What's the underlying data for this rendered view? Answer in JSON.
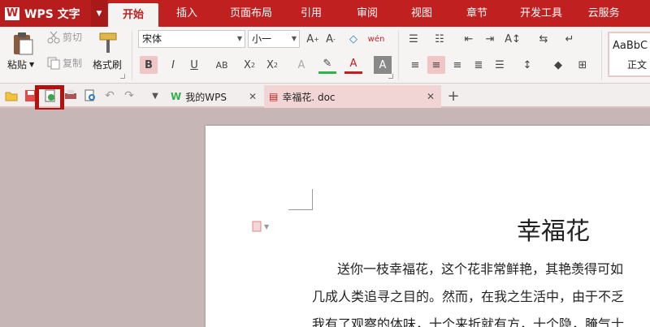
{
  "app": {
    "name": "WPS 文字",
    "logo": "W"
  },
  "tabs": [
    {
      "label": "开始",
      "active": true
    },
    {
      "label": "插入"
    },
    {
      "label": "页面布局"
    },
    {
      "label": "引用"
    },
    {
      "label": "审阅"
    },
    {
      "label": "视图"
    },
    {
      "label": "章节"
    },
    {
      "label": "开发工具"
    },
    {
      "label": "云服务"
    }
  ],
  "ribbon": {
    "paste": "粘贴",
    "cut": "剪切",
    "copy": "复制",
    "format_painter": "格式刷",
    "font_name": "宋体",
    "font_size": "小一",
    "style_preview": "AaBbC",
    "style_name": "正文"
  },
  "doc_tabs": [
    {
      "label": "我的WPS"
    },
    {
      "label": "幸福花. doc",
      "active": true
    }
  ],
  "document": {
    "title": "幸福花",
    "lines": [
      "送你一枝幸福花，这个花非常鲜艳，其艳羡得可如",
      "几成人类追寻之目的。然而，在我之生活中，由于不乏",
      "我有了观察的体味，十个来折就有方，十个隐，腌气士"
    ]
  },
  "colors": {
    "brand": "#c0201f",
    "highlight": "#b5120f"
  }
}
